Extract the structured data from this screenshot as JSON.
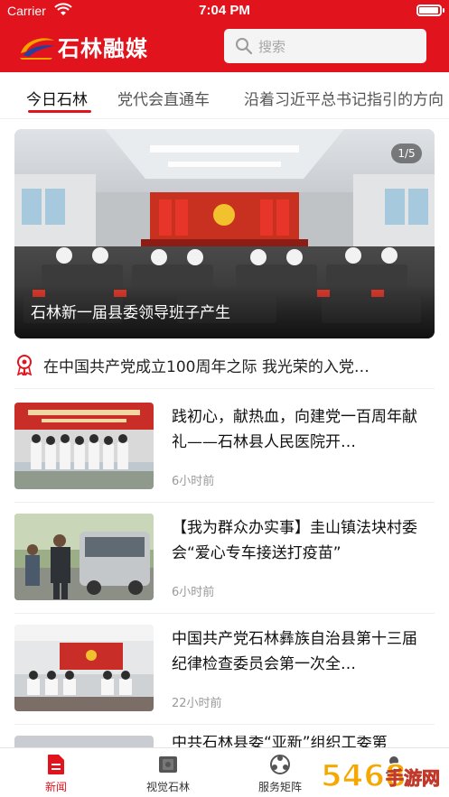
{
  "status_bar": {
    "carrier": "Carrier",
    "time": "7:04 PM",
    "battery_level": 0.95
  },
  "header": {
    "logo_text": "石林融媒",
    "search_placeholder": "搜索"
  },
  "tabs": [
    {
      "label": "今日石林",
      "active": true
    },
    {
      "label": "党代会直通车",
      "active": false
    },
    {
      "label": "沿着习近平总书记指引的方向",
      "active": false
    }
  ],
  "banner": {
    "caption": "石林新一届县委领导班子产生",
    "counter": "1/5"
  },
  "notice": {
    "text": "在中国共产党成立100周年之际 我光荣的入党…"
  },
  "news": [
    {
      "title": "践初心，献热血，向建党一百周年献礼——石林县人民医院开…",
      "time": "6小时前"
    },
    {
      "title": "【我为群众办实事】圭山镇法块村委会“爱心专车接送打疫苗”",
      "time": "6小时前"
    },
    {
      "title": "中国共产党石林彝族自治县第十三届纪律检查委员会第一次全…",
      "time": "22小时前"
    },
    {
      "title": "中共石林县委“亚新”组织工委第",
      "time": ""
    }
  ],
  "tabbar": [
    {
      "label": "新闻",
      "icon": "news-icon",
      "active": true
    },
    {
      "label": "视觉石林",
      "icon": "video-icon",
      "active": false
    },
    {
      "label": "服务矩阵",
      "icon": "service-icon",
      "active": false
    },
    {
      "label": "",
      "icon": "user-icon",
      "active": false
    }
  ],
  "watermark": {
    "text": "手游网",
    "logo_text": "5468"
  },
  "colors": {
    "brand_red": "#e1141e",
    "text_dark": "#111111",
    "text_muted": "#9a9a9a"
  }
}
